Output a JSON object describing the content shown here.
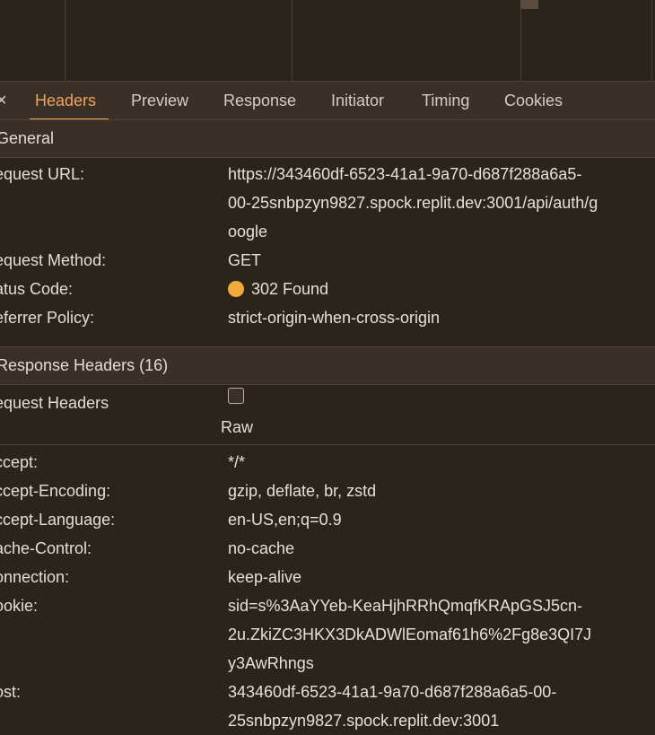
{
  "tabs": {
    "close_glyph": "×",
    "items": [
      "Headers",
      "Preview",
      "Response",
      "Initiator",
      "Timing",
      "Cookies"
    ],
    "active": "Headers"
  },
  "general": {
    "title": "General",
    "request_url_key": "equest URL:",
    "request_url_lines": [
      "https://343460df-6523-41a1-9a70-d687f288a6a5-",
      "00-25snbpzyn9827.spock.replit.dev:3001/api/auth/g",
      "oogle"
    ],
    "request_method_key": "equest Method:",
    "request_method": "GET",
    "status_key": "atus Code:",
    "status": "302 Found",
    "status_color": "#f2a93b",
    "referrer_key": "eferrer Policy:",
    "referrer": "strict-origin-when-cross-origin"
  },
  "response_headers": {
    "title": "Response Headers (16)"
  },
  "request_headers": {
    "title": "equest Headers",
    "raw_label": "Raw",
    "raw_checked": false,
    "rows": [
      {
        "key": "ccept:",
        "value": "*/*"
      },
      {
        "key": "ccept-Encoding:",
        "value": "gzip, deflate, br, zstd"
      },
      {
        "key": "ccept-Language:",
        "value": "en-US,en;q=0.9"
      },
      {
        "key": "ache-Control:",
        "value": "no-cache"
      },
      {
        "key": "onnection:",
        "value": "keep-alive"
      }
    ],
    "cookie_key": "ookie:",
    "cookie_lines": [
      "sid=s%3AaYYeb-KeaHjhRRhQmqfKRApGSJ5cn-",
      "2u.ZkiZC3HKX3DkADWlEomaf61h6%2Fg8e3QI7J",
      "y3AwRhngs"
    ],
    "host_key": "ost:",
    "host_lines": [
      "343460df-6523-41a1-9a70-d687f288a6a5-00-",
      "25snbpzyn9827.spock.replit.dev:3001"
    ]
  },
  "colors": {
    "accent": "#f0a45a",
    "background": "#2b241d",
    "panel": "#3a3027"
  }
}
